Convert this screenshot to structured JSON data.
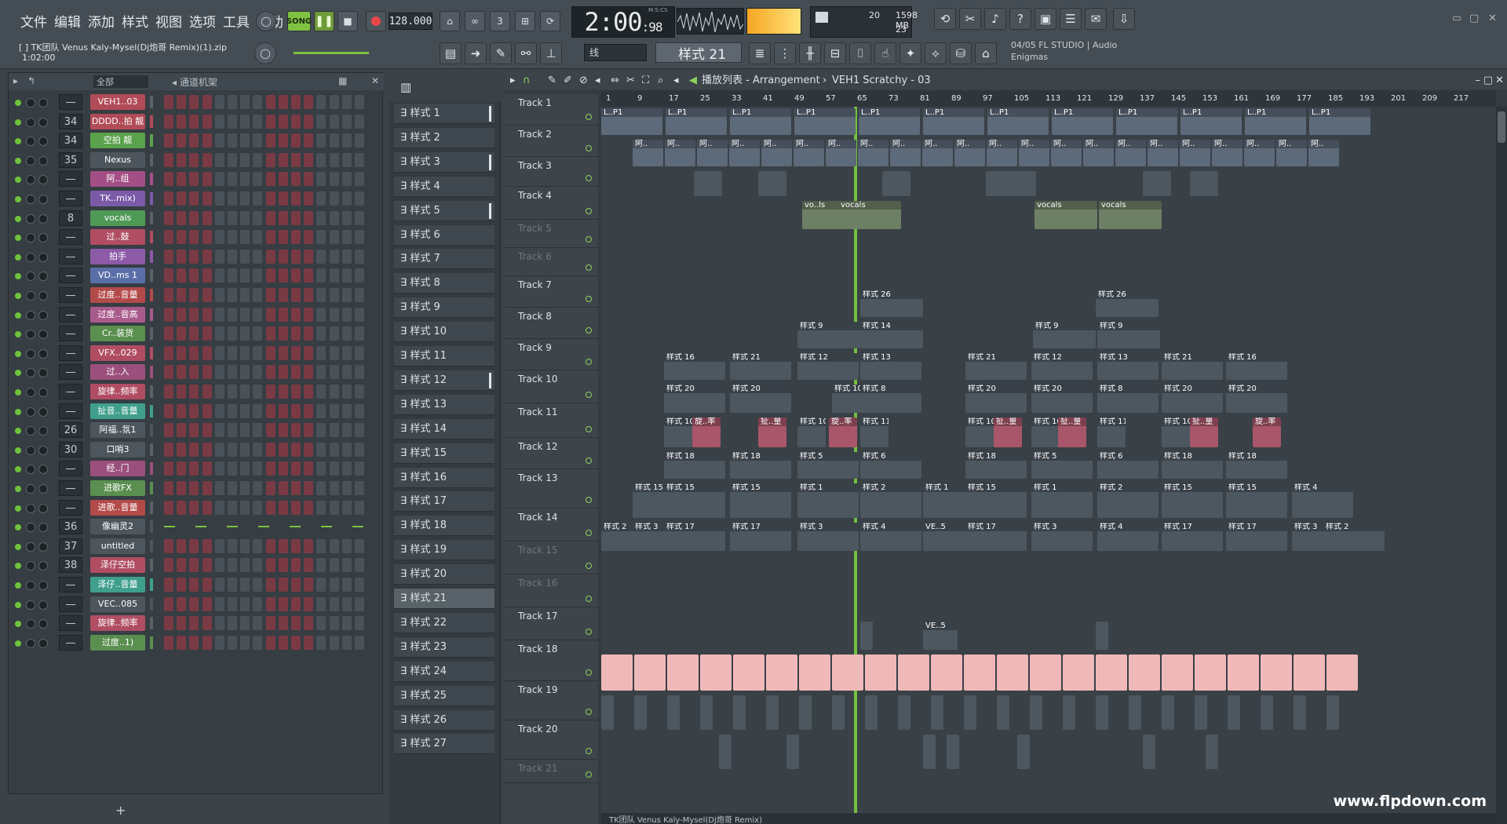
{
  "menu": [
    "文件",
    "编辑",
    "添加",
    "样式",
    "视图",
    "选项",
    "工具",
    "帮助"
  ],
  "transport": {
    "song_label": "SONG",
    "bpm": "128.000",
    "time": "2:00",
    "time_ticks": "98",
    "time_unit": "M:S:CS"
  },
  "cpu": {
    "meter": "20",
    "mem": "1598 MB",
    "poly": "23"
  },
  "project": {
    "file": "[ ] TK团队 Venus Kaly-Mysel(Dj炮哥 Remix)(1).zip",
    "length": "1:02:00"
  },
  "snap": "线",
  "current_pattern": "样式 21",
  "info": {
    "line1": "04/05  FL STUDIO | Audio",
    "line2": "Enigmas"
  },
  "rack": {
    "filter": "全部",
    "title": "通道机架",
    "add": "+",
    "channels": [
      {
        "num": "—",
        "name": "VEH1..03",
        "color": "#b14b57"
      },
      {
        "num": "34",
        "name": "DDDD..拍 靓",
        "color": "#b14b57"
      },
      {
        "num": "34",
        "name": "空拍 靓",
        "color": "#5aa24b"
      },
      {
        "num": "35",
        "name": "Nexus",
        "color": "#4e565d"
      },
      {
        "num": "—",
        "name": "阿..组",
        "color": "#a34f85"
      },
      {
        "num": "—",
        "name": "TK..mix)",
        "color": "#7b5aa8"
      },
      {
        "num": "8",
        "name": "vocals",
        "color": "#4f9a57"
      },
      {
        "num": "—",
        "name": "过..鼓",
        "color": "#b04d63"
      },
      {
        "num": "—",
        "name": "拍手",
        "color": "#8d5aa8"
      },
      {
        "num": "—",
        "name": "VD..ms 1",
        "color": "#5a6fa8"
      },
      {
        "num": "—",
        "name": "过度..音量",
        "color": "#b34a4a"
      },
      {
        "num": "—",
        "name": "过度..音高",
        "color": "#a95a8c"
      },
      {
        "num": "—",
        "name": "Cr..装货",
        "color": "#5a8f4f"
      },
      {
        "num": "—",
        "name": "VFX..029",
        "color": "#b04d63"
      },
      {
        "num": "—",
        "name": "过..入",
        "color": "#9b4f7d"
      },
      {
        "num": "—",
        "name": "旋律..频率",
        "color": "#b04d63"
      },
      {
        "num": "—",
        "name": "扯音..音量",
        "color": "#3f9f8c"
      },
      {
        "num": "26",
        "name": "阿福..氛1",
        "color": "#4e565d"
      },
      {
        "num": "30",
        "name": "口哨3",
        "color": "#4e565d"
      },
      {
        "num": "—",
        "name": "经..门",
        "color": "#9b4f7d"
      },
      {
        "num": "—",
        "name": "进歌FX",
        "color": "#5a8f4f"
      },
      {
        "num": "—",
        "name": "进歌..音量",
        "color": "#b34a4a"
      },
      {
        "num": "36",
        "name": "像幽灵2",
        "color": "#4e565d"
      },
      {
        "num": "37",
        "name": "untitled",
        "color": "#4e565d"
      },
      {
        "num": "38",
        "name": "泽仔空拍",
        "color": "#b04d63"
      },
      {
        "num": "—",
        "name": "泽仔..音量",
        "color": "#3f9f8c"
      },
      {
        "num": "—",
        "name": "VEC..085",
        "color": "#4e565d"
      },
      {
        "num": "—",
        "name": "旋律..频率",
        "color": "#b04d63"
      },
      {
        "num": "—",
        "name": "过度..1)",
        "color": "#5a8f4f"
      }
    ]
  },
  "patterns": [
    "样式 1",
    "样式 2",
    "样式 3",
    "样式 4",
    "样式 5",
    "样式 6",
    "样式 7",
    "样式 8",
    "样式 9",
    "样式 10",
    "样式 11",
    "样式 12",
    "样式 13",
    "样式 14",
    "样式 15",
    "样式 16",
    "样式 17",
    "样式 18",
    "样式 19",
    "样式 20",
    "样式 21",
    "样式 22",
    "样式 23",
    "样式 24",
    "样式 25",
    "样式 26",
    "样式 27"
  ],
  "playlist": {
    "title": "播放列表 - Arrangement",
    "crumb": "VEH1 Scratchy - 03",
    "ruler": [
      "1",
      "9",
      "17",
      "25",
      "33",
      "41",
      "49",
      "57",
      "65",
      "73",
      "81",
      "89",
      "97",
      "105",
      "113",
      "121",
      "129",
      "137",
      "145",
      "153",
      "161",
      "169",
      "177",
      "185",
      "193",
      "201",
      "209",
      "217"
    ],
    "tracks": [
      "Track 1",
      "Track 2",
      "Track 3",
      "Track 4",
      "Track 5",
      "Track 6",
      "Track 7",
      "Track 8",
      "Track 9",
      "Track 10",
      "Track 11",
      "Track 12",
      "Track 13",
      "Track 14",
      "Track 15",
      "Track 16",
      "Track 17",
      "Track 18",
      "Track 19",
      "Track 20",
      "Track 21"
    ],
    "clip_labels": {
      "l_p1": "L..P1",
      "a": "阿..",
      "vols": "vo..ls",
      "vocals": "vocals",
      "p26": "样式 26",
      "p9": "样式 9",
      "p14": "样式 14",
      "p16": "样式 16",
      "p21": "样式 21",
      "p12": "样式 12",
      "p13": "样式 13",
      "p20": "样式 20",
      "p8": "样式 8",
      "p11": "样式 11",
      "p18": "样式 18",
      "p5": "样式 5",
      "p6": "样式 6",
      "p15": "样式 15",
      "p1": "样式 1",
      "p2": "样式 2",
      "p17": "样式 17",
      "p3": "样式 3",
      "p4": "样式 4",
      "ve5": "VE..5",
      "xuan": "旋..率",
      "kuo": "扯..量",
      "p10": "样式 10"
    },
    "footer": "TK团队 Venus Kaly-Mysel(Dj炮哥 Remix)"
  },
  "watermark": "www.flpdown.com"
}
